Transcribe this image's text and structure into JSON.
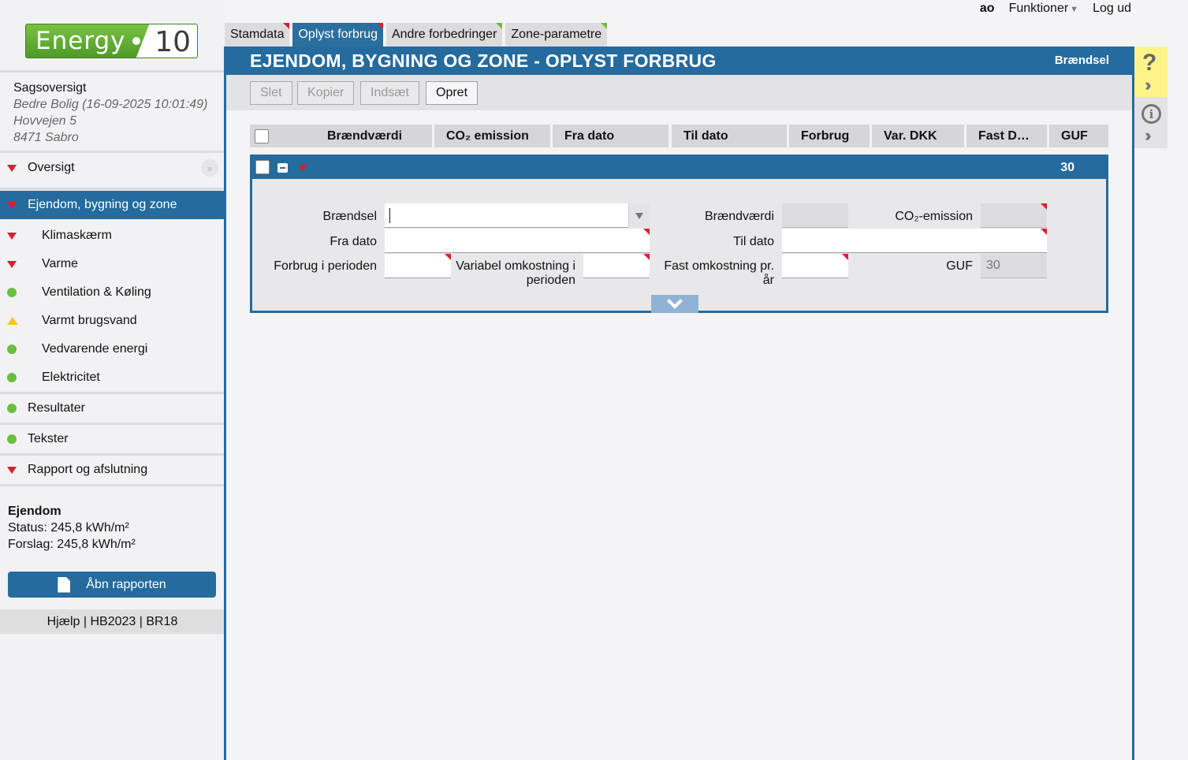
{
  "topbar": {
    "user": "ao",
    "functions": "Funktioner",
    "logout": "Log ud"
  },
  "logo": {
    "word": "Energy",
    "version": "10"
  },
  "case": {
    "title": "Sagsoversigt",
    "line1": "Bedre Bolig (16-09-2025 10:01:49)",
    "line2": "Hovvejen 5",
    "line3": "8471 Sabro"
  },
  "nav": {
    "overview": "Oversigt",
    "active": "Ejendom, bygning og zone",
    "sub": [
      {
        "label": "Klimaskærm",
        "status": "red"
      },
      {
        "label": "Varme",
        "status": "red"
      },
      {
        "label": "Ventilation & Køling",
        "status": "green"
      },
      {
        "label": "Varmt brugsvand",
        "status": "yellow"
      },
      {
        "label": "Vedvarende energi",
        "status": "green"
      },
      {
        "label": "Elektricitet",
        "status": "green"
      }
    ],
    "results": "Resultater",
    "texts": "Tekster",
    "report": "Rapport og afslutning"
  },
  "summary": {
    "title": "Ejendom",
    "status": "Status: 245,8 kWh/m²",
    "proposal": "Forslag: 245,8 kWh/m²"
  },
  "open_report": "Åbn rapporten",
  "footer_links": "Hjælp | HB2023 | BR18",
  "tabs": [
    "Stamdata",
    "Oplyst forbrug",
    "Andre forbedringer",
    "Zone-parametre"
  ],
  "header": {
    "title": "EJENDOM, BYGNING OG ZONE - OPLYST FORBRUG",
    "crumb": "Brændsel"
  },
  "toolbar": {
    "delete": "Slet",
    "copy": "Kopier",
    "paste": "Indsæt",
    "create": "Opret"
  },
  "columns": [
    "Brændværdi",
    "CO₂ emission",
    "Fra dato",
    "Til dato",
    "Forbrug",
    "Var. DKK",
    "Fast D…",
    "GUF"
  ],
  "record": {
    "header_value": "30",
    "labels": {
      "fuel": "Brændsel",
      "calorific": "Brændværdi",
      "co2": "CO₂-emission",
      "from": "Fra dato",
      "to": "Til dato",
      "consumption": "Forbrug i perioden",
      "variable_1": "Variabel omkostning i",
      "variable_2": "perioden",
      "fixed_1": "Fast omkostning pr.",
      "fixed_2": "år",
      "guf": "GUF"
    },
    "guf_value": "30"
  },
  "rail": {
    "help": "?",
    "info": "i"
  }
}
